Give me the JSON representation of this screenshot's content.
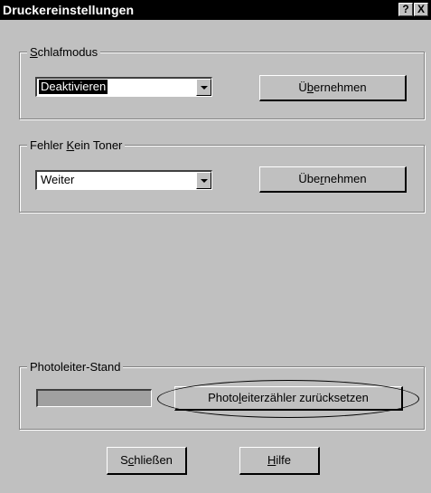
{
  "window": {
    "title": "Druckereinstellungen",
    "help_label": "?",
    "close_label": "X"
  },
  "sleep_mode": {
    "legend_prefix": "",
    "legend_mnemonic": "S",
    "legend_rest": "chlafmodus",
    "selected_value": "Deaktivieren",
    "apply_prefix": "Ü",
    "apply_mnemonic": "b",
    "apply_rest": "ernehmen"
  },
  "no_toner": {
    "legend_prefix": "Fehler ",
    "legend_mnemonic": "K",
    "legend_rest": "ein Toner",
    "selected_value": "Weiter",
    "apply_prefix": "Übe",
    "apply_mnemonic": "r",
    "apply_rest": "nehmen"
  },
  "photoconductor": {
    "legend": "Photoleiter-Stand",
    "level_fraction": 0,
    "reset_prefix": "Photo",
    "reset_mnemonic": "l",
    "reset_rest": "eiterzähler zurücksetzen"
  },
  "footer": {
    "close_prefix": "S",
    "close_mnemonic": "c",
    "close_rest": "hließen",
    "help_prefix": "",
    "help_mnemonic": "H",
    "help_rest": "ilfe"
  },
  "colors": {
    "dialog_face": "#c0c0c0",
    "titlebar": "#000000",
    "selection": "#000000"
  }
}
